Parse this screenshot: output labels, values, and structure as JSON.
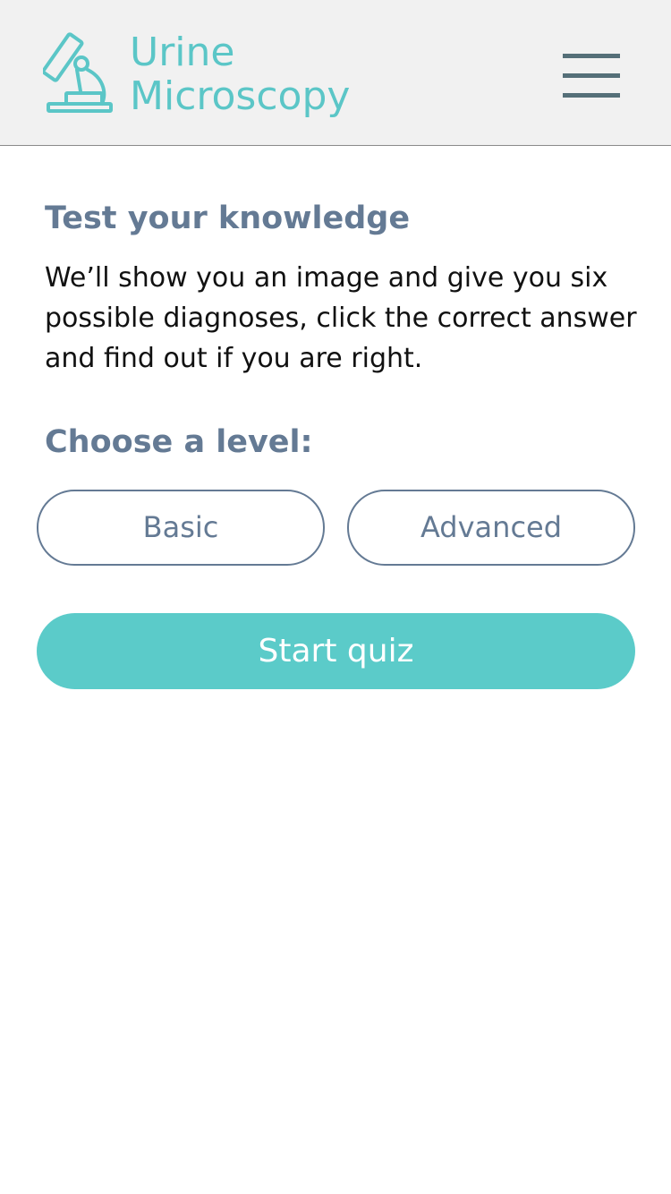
{
  "app": {
    "title_line1": "Urine",
    "title_line2": "Microscopy",
    "logo_icon": "microscope-icon",
    "menu_icon": "hamburger-menu-icon"
  },
  "intro": {
    "heading": "Test your knowledge",
    "description": "We’ll show you an image and give you six possible diagnoses, click the correct answer and find out if you are right."
  },
  "level": {
    "heading": "Choose a level:",
    "options": [
      "Basic",
      "Advanced"
    ]
  },
  "start_button": {
    "label": "Start quiz"
  },
  "colors": {
    "brand": "#5bc6c7",
    "heading": "#647a94",
    "menu": "#556f78",
    "button_fill": "#5bcbc9",
    "header_bg": "#f1f1f1"
  }
}
